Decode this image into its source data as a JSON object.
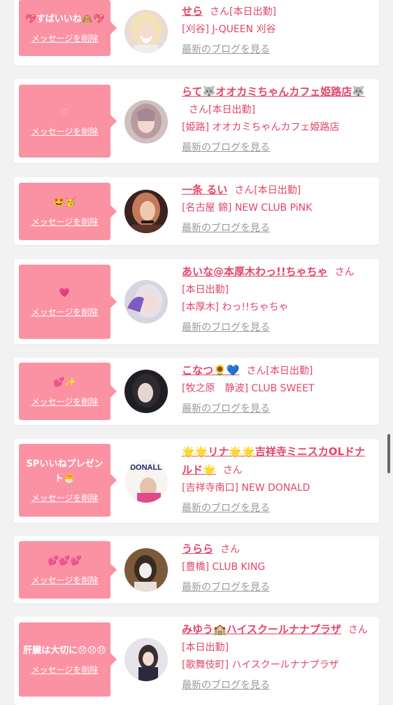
{
  "delete_label": "メッセージを削除",
  "suffix_san": "さん",
  "blog_label": "最新のブログを見る",
  "colors": {
    "background": "#f2f2f2",
    "bubble": "#fb92a4",
    "name": "#e2466a",
    "link_gray": "#9a9a9a"
  },
  "messages": [
    {
      "message": "💖すばいいね🙈💖",
      "name": "せら",
      "status": "[本日出勤]",
      "store": "[刈谷] J-QUEEN 刈谷",
      "avatar_icon": "avatar-blonde-girl-icon"
    },
    {
      "message": "♡",
      "name": "らて🐺オオカミちゃんカフェ姫路店🐺",
      "status": "[本日出勤]",
      "store": "[姫路] オオカミちゃんカフェ姫路店",
      "avatar_icon": "avatar-pink-hair-girl-icon"
    },
    {
      "message": "🤩🥳",
      "name": "一条 るい",
      "status": "[本日出勤]",
      "store": "[名古屋 錦] NEW CLUB PiNK",
      "avatar_icon": "avatar-choker-girl-icon"
    },
    {
      "message": "💗",
      "name": "あいな@本厚木わっ!!ちゃちゃ",
      "status": "[本日出勤]",
      "store": "[本厚木] わっ!!ちゃちゃ",
      "avatar_icon": "avatar-purple-nails-girl-icon"
    },
    {
      "message": "💕✨",
      "name": "こなつ🌻💙",
      "status": "[本日出勤]",
      "store": "[牧之原　静波] CLUB SWEET",
      "avatar_icon": "avatar-dark-hair-girl-icon"
    },
    {
      "message": "SPいいねプレゼント🐣",
      "name": "🌟🌟リナ🌟🌟吉祥寺ミニスカOLドナルド🌟",
      "status": "",
      "store": "[吉祥寺南口] NEW DONALD",
      "avatar_icon": "avatar-donald-logo-icon",
      "avatar_text": "DONALL"
    },
    {
      "message": "💕💕💕",
      "name": "うらら",
      "status": "",
      "store": "[豊橋] CLUB KING",
      "avatar_icon": "avatar-masked-girl-icon"
    },
    {
      "message": "肝臓は大切に😞😞😞",
      "name": "みゆう🏫ハイスクールナナプラザ",
      "status": "[本日出勤]",
      "store": "[歌舞伎町] ハイスクールナナプラザ",
      "avatar_icon": "avatar-schoolgirl-icon"
    }
  ]
}
